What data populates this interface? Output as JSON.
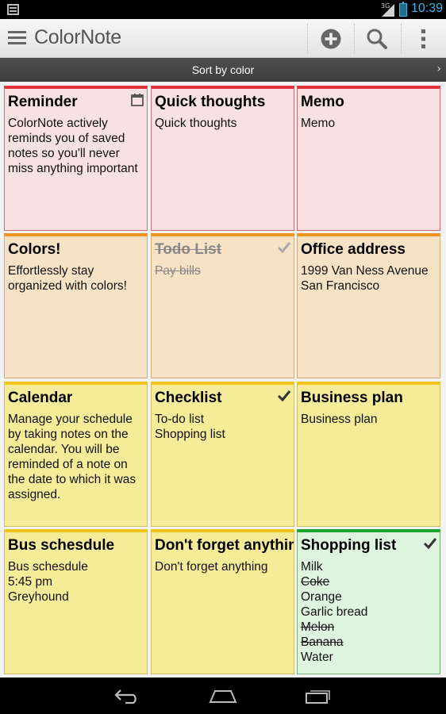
{
  "status_bar": {
    "network": "3G",
    "time": "10:39",
    "accent_color": "#33b5e5"
  },
  "action_bar": {
    "app_title": "ColorNote",
    "menu_icon": "hamburger-menu-icon",
    "add_icon": "add-note-icon",
    "search_icon": "search-icon",
    "overflow_icon": "overflow-menu-icon"
  },
  "sort_bar": {
    "label": "Sort by color",
    "chevron": "›"
  },
  "notes": [
    {
      "title": "Reminder",
      "color": "red",
      "icon": "calendar-reminder-icon",
      "lines": [
        "ColorNote actively reminds you of saved notes so you'll never miss anything important"
      ]
    },
    {
      "title": "Quick thoughts",
      "color": "red",
      "lines": [
        "Quick thoughts"
      ]
    },
    {
      "title": "Memo",
      "color": "red",
      "lines": [
        "Memo"
      ]
    },
    {
      "title": "Colors!",
      "color": "orange",
      "lines": [
        "Effortlessly stay organized with colors!"
      ]
    },
    {
      "title": "Todo List",
      "color": "orange",
      "checked": true,
      "icon": "checkmark-icon",
      "lines": [
        "Pay bills"
      ]
    },
    {
      "title": "Office address",
      "color": "orange",
      "lines": [
        "1999 Van Ness Avenue",
        "San Francisco"
      ]
    },
    {
      "title": "Calendar",
      "color": "yellow",
      "lines": [
        "Manage your schedule by taking notes on the calendar. You will be reminded of a note on the date to which it was assigned."
      ]
    },
    {
      "title": "Checklist",
      "color": "yellow",
      "icon": "checkmark-icon",
      "lines": [
        "To-do list",
        "Shopping list"
      ]
    },
    {
      "title": "Business plan",
      "color": "yellow",
      "lines": [
        "Business plan"
      ]
    },
    {
      "title": "Bus schesdule",
      "color": "yellow",
      "lines": [
        "Bus schesdule",
        "5:45 pm",
        "Greyhound"
      ]
    },
    {
      "title": "Don't forget anything",
      "color": "yellow",
      "lines": [
        "Don't forget anything"
      ]
    },
    {
      "title": "Shopping list",
      "color": "green",
      "icon": "checkmark-icon",
      "items": [
        {
          "text": "Milk",
          "checked": false
        },
        {
          "text": "Coke",
          "checked": true
        },
        {
          "text": "Orange",
          "checked": false
        },
        {
          "text": "Garlic bread",
          "checked": false
        },
        {
          "text": "Melon",
          "checked": true
        },
        {
          "text": "Banana",
          "checked": true
        },
        {
          "text": "Water",
          "checked": false
        }
      ]
    }
  ],
  "nav_bar": {
    "back_icon": "back-icon",
    "home_icon": "home-icon",
    "recents_icon": "recent-apps-icon"
  }
}
